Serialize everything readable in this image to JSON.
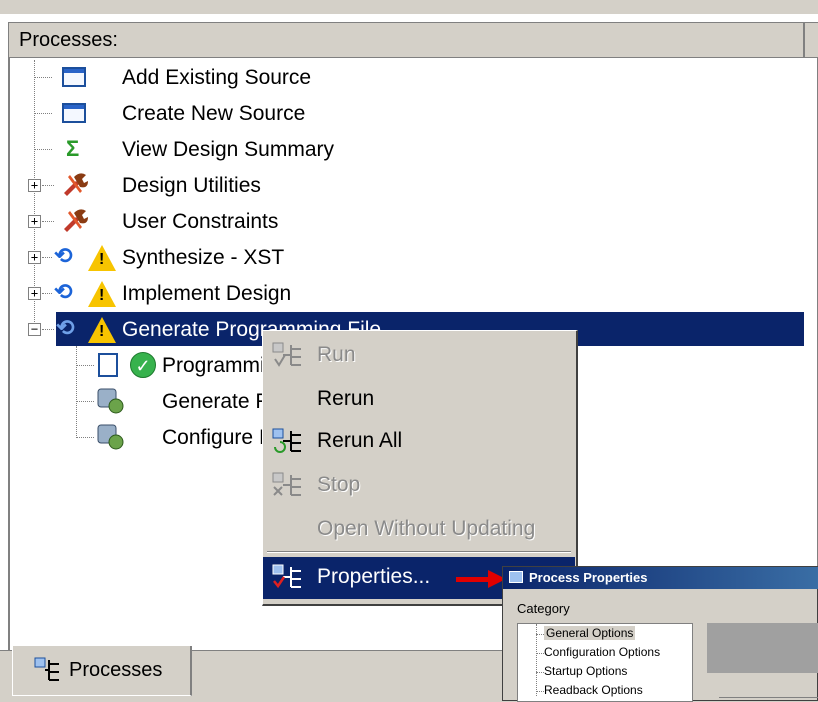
{
  "panel": {
    "header": "Processes:"
  },
  "tree": [
    {
      "label": "Add Existing Source",
      "icon": "window-icon"
    },
    {
      "label": "Create New Source",
      "icon": "window-icon"
    },
    {
      "label": "View Design Summary",
      "icon": "sigma-icon"
    },
    {
      "label": "Design Utilities",
      "icon": "tools-icon",
      "expander": "+"
    },
    {
      "label": "User Constraints",
      "icon": "tools-icon",
      "expander": "+"
    },
    {
      "label": "Synthesize - XST",
      "icon": "refresh-warning-icon",
      "expander": "+"
    },
    {
      "label": "Implement Design",
      "icon": "refresh-warning-icon",
      "expander": "+"
    },
    {
      "label": "Generate Programming File",
      "icon": "refresh-warning-icon",
      "expander": "−",
      "selected": true
    },
    {
      "label": "Programmi",
      "icon": "report-check-icon"
    },
    {
      "label": "Generate F",
      "icon": "process-gear-icon"
    },
    {
      "label": "Configure I",
      "icon": "process-gear-icon"
    }
  ],
  "context_menu": {
    "items": [
      {
        "label": "Run",
        "enabled": false
      },
      {
        "label": "Rerun",
        "enabled": true
      },
      {
        "label": "Rerun All",
        "enabled": true
      },
      {
        "label": "Stop",
        "enabled": false
      },
      {
        "label": "Open Without Updating",
        "enabled": false
      },
      {
        "label": "Properties...",
        "enabled": true,
        "highlighted": true
      }
    ]
  },
  "bottom_tab": {
    "label": "Processes"
  },
  "dialog": {
    "title": "Process Properties",
    "category_label": "Category",
    "categories": [
      {
        "label": "General Options",
        "selected": true
      },
      {
        "label": "Configuration Options"
      },
      {
        "label": "Startup Options"
      },
      {
        "label": "Readback Options"
      }
    ]
  },
  "colors": {
    "selection": "#0a246a",
    "chrome": "#d4d0c8",
    "arrow": "#e00000",
    "warning": "#f7c400",
    "check": "#37b24d"
  }
}
